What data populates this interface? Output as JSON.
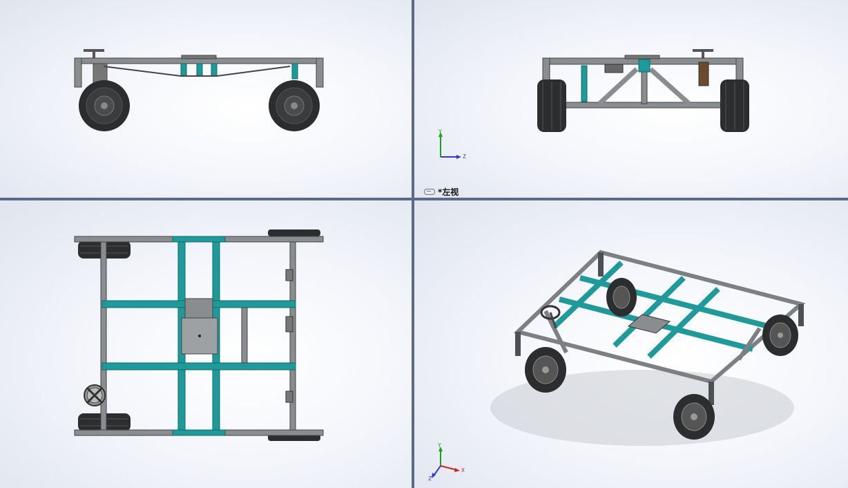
{
  "viewports": {
    "front": {
      "label": ""
    },
    "left": {
      "label": "*左视"
    },
    "top": {
      "label": ""
    },
    "iso": {
      "label": ""
    }
  },
  "triad": {
    "left": {
      "y": "Y",
      "z": "Z"
    },
    "iso": {
      "y": "Y",
      "x": "X",
      "z": "Z"
    }
  },
  "colors": {
    "frame": "#7d8083",
    "frame_dark": "#4e5153",
    "teal": "#1f9a9a",
    "teal_dark": "#0f6b6b",
    "tire": "#2b2d2f",
    "hub": "#9a9c9f",
    "y_axis": "#19a319",
    "z_axis": "#2a3bd6",
    "x_axis": "#d22222"
  }
}
